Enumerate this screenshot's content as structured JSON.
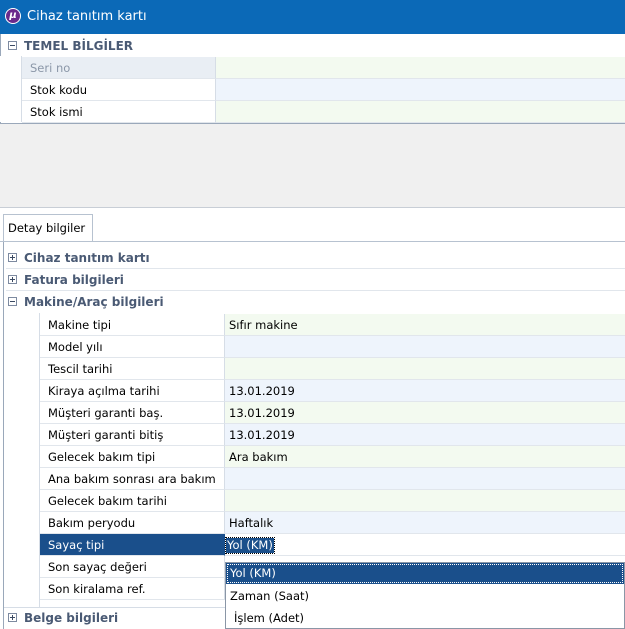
{
  "window": {
    "title": "Cihaz tanıtım kartı",
    "logo_letter": "μ"
  },
  "top_section": {
    "group_title": "TEMEL BİLGİLER",
    "rows": [
      {
        "label": "Seri no",
        "value": ""
      },
      {
        "label": "Stok kodu",
        "value": ""
      },
      {
        "label": "Stok ismi",
        "value": ""
      }
    ]
  },
  "tabs": [
    {
      "label": "Detay bilgiler"
    }
  ],
  "groups": {
    "cihaz": "Cihaz tanıtım kartı",
    "fatura": "Fatura bilgileri",
    "makine": "Makine/Araç bilgileri",
    "belge": "Belge bilgileri"
  },
  "makine_rows": [
    {
      "label": "Makine tipi",
      "value": "Sıfır makine"
    },
    {
      "label": "Model yılı",
      "value": ""
    },
    {
      "label": "Tescil tarihi",
      "value": ""
    },
    {
      "label": "Kiraya açılma tarihi",
      "value": "13.01.2019"
    },
    {
      "label": "Müşteri garanti baş.",
      "value": "13.01.2019"
    },
    {
      "label": "Müşteri garanti bitiş",
      "value": "13.01.2019"
    },
    {
      "label": "Gelecek bakım tipi",
      "value": "Ara bakım"
    },
    {
      "label": "Ana bakım sonrası ara bakım",
      "value": ""
    },
    {
      "label": "Gelecek bakım tarihi",
      "value": ""
    },
    {
      "label": "Bakım peryodu",
      "value": "Haftalık"
    },
    {
      "label": "Sayaç tipi",
      "value": "Yol (KM)"
    },
    {
      "label": "Son sayaç değeri",
      "value": ""
    },
    {
      "label": "Son kiralama ref.",
      "value": ""
    }
  ],
  "dropdown": {
    "options": [
      "Yol (KM)",
      "Zaman (Saat)",
      "İşlem (Adet)"
    ],
    "selected_index": 0
  },
  "colors": {
    "titlebar": "#0b69b7",
    "selection": "#1a4f8b",
    "row_value_bg_alt": "#eef4fc",
    "row_value_bg_green": "#f3faf0",
    "group_text": "#4a5a74"
  }
}
